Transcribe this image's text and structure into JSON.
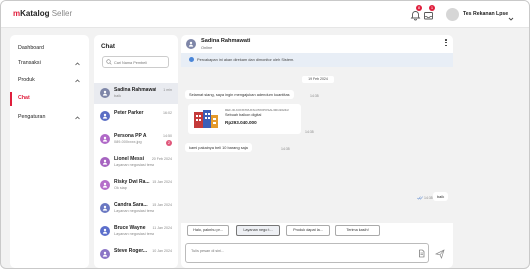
{
  "app": {
    "brand": "Katalog",
    "brand_suffix": " Seller"
  },
  "topbar": {
    "notif_count": "8",
    "inbox_count": "1",
    "user_name": "Tes Rekanan Lpse"
  },
  "sidebar": {
    "items": [
      {
        "label": "Dashboard",
        "chevron": false,
        "active": false
      },
      {
        "label": "Transaksi",
        "chevron": true,
        "active": false
      },
      {
        "label": "Produk",
        "chevron": true,
        "active": false
      },
      {
        "label": "Chat",
        "chevron": false,
        "active": true
      },
      {
        "label": "Pengaturan",
        "chevron": true,
        "active": false
      }
    ]
  },
  "chatlist": {
    "title": "Chat",
    "search_placeholder": "Cari Nama Pembeli",
    "items": [
      {
        "name": "Sadina Rahmawati",
        "preview": "baik",
        "time": "1 min",
        "color": "#7e86a8",
        "unread": "",
        "selected": true
      },
      {
        "name": "Peter Parker",
        "preview": "",
        "time": "16:02",
        "color": "#5b6ec4",
        "unread": "",
        "selected": false
      },
      {
        "name": "Persona PP A",
        "preview": "089-000xxxx.jpg",
        "time": "14:50",
        "color": "#b069c7",
        "unread": "2",
        "selected": false
      },
      {
        "name": "Lionel Messi",
        "preview": "Layanan negosiasi tersedia...",
        "time": "20 Feb 2024",
        "color": "#a664c0",
        "unread": "",
        "selected": false
      },
      {
        "name": "Risky Dwi Ra...",
        "preview": "Ok siap",
        "time": "15 Jan 2024",
        "color": "#b56ec9",
        "unread": "",
        "selected": false
      },
      {
        "name": "Candra Sara...",
        "preview": "Layanan negosiasi tersedia...",
        "time": "15 Jan 2024",
        "color": "#6a78c2",
        "unread": "",
        "selected": false
      },
      {
        "name": "Bruce Wayne",
        "preview": "Layanan negosiasi tersedia...",
        "time": "11 Jan 2024",
        "color": "#5c6fcb",
        "unread": "",
        "selected": false
      },
      {
        "name": "Steve Roger...",
        "preview": "",
        "time": "10 Jan 2024",
        "color": "#8a74c6",
        "unread": "",
        "selected": false
      }
    ]
  },
  "chat": {
    "contact_name": "Sadina Rahmawati",
    "contact_status": "Online",
    "notice": "Percakapan ini akan direkam dan dimonitor oleh Sistem.",
    "date_label": "19 Feb 2024",
    "messages": [
      {
        "text": "Selamat siang, saya ingin mengajukan adendum kuantitas",
        "time": "14:35"
      },
      {
        "text": "kami pakainya beli 10 barang saja",
        "time": "14:35"
      },
      {
        "text": "baik",
        "time": "14:35"
      }
    ],
    "product": {
      "ref": "REF-ID-KONSTRUKSI-PROPOSAL/001/2024/2",
      "name": "Sebuah balkon digital",
      "price": "Rp293.040.000",
      "time": "14:35"
    },
    "quick_replies": [
      "Halo, paknhu pr...",
      "Layanan nego t...",
      "Produk dapat la...",
      "Terima kasih!"
    ],
    "input_placeholder": "Tulis pesan di sini..."
  },
  "colors": {
    "brand": "#e01e3c",
    "accent": "#4a86d8"
  }
}
